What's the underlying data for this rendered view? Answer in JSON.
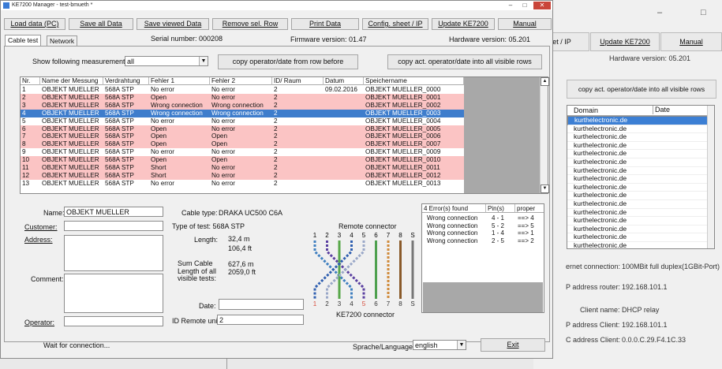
{
  "bg_window": {
    "controls": {
      "minimize": "–",
      "maximize": "□"
    },
    "toolbar_partial": [
      "et / IP",
      "Update KE7200",
      "Manual"
    ],
    "hardware_version": "Hardware version:  05.201",
    "copy_button": "copy act. operator/date into all visible rows",
    "list": {
      "columns": [
        "Domain",
        "Date"
      ],
      "rows": [
        "kurthelectronic.de",
        "kurthelectronic.de",
        "kurthelectronic.de",
        "kurthelectronic.de",
        "kurthelectronic.de",
        "kurthelectronic.de",
        "kurthelectronic.de",
        "kurthelectronic.de",
        "kurthelectronic.de",
        "kurthelectronic.de",
        "kurthelectronic.de",
        "kurthelectronic.de",
        "kurthelectronic.de",
        "kurthelectronic.de",
        "kurthelectronic.de",
        "kurthelectronic.de",
        "kurthelectronic.de",
        "kurthelectronic.de"
      ],
      "selected_index": 0
    },
    "info": [
      {
        "label": "ernet connection:",
        "value": "100MBit full duplex(1GBit-Port)"
      },
      {
        "label": "P address router:",
        "value": "192.168.101.1"
      },
      {
        "label": "Client name:",
        "value": "DHCP relay"
      },
      {
        "label": "P address Client:",
        "value": "192.168.101.1"
      },
      {
        "label": "C address Client:",
        "value": "0.0.0.C.29.F4.1C.33"
      }
    ]
  },
  "window": {
    "title": "KE7200 Manager - test-bmueth *",
    "controls": {
      "minimize": "–",
      "maximize": "□",
      "close": "✕"
    }
  },
  "toolbar": [
    "Load data (PC)",
    "Save all Data",
    "Save viewed Data",
    "Remove sel. Row",
    "Print Data",
    "Config. sheet / IP",
    "Update KE7200",
    "Manual"
  ],
  "tabs": [
    "Cable test",
    "Network"
  ],
  "serial": "Serial number: 000208",
  "firmware": "Firmware version:  01.47",
  "hardware": "Hardware version:  05.201",
  "filter": {
    "label": "Show following measurements:",
    "value": "all"
  },
  "buttons": {
    "copy_before": "copy operator/date from row before",
    "copy_all": "copy act. operator/date into all visible rows"
  },
  "table": {
    "columns": [
      "Nr.",
      "Name der Messung",
      "Verdrahtung",
      "Fehler 1",
      "Fehler 2",
      "ID/ Raum",
      "Datum",
      "Speichername"
    ],
    "rows": [
      {
        "nr": "1",
        "name": "OBJEKT MUELLER",
        "wiring": "568A STP",
        "f1": "No error",
        "f2": "No error",
        "id": "2",
        "date": "09.02.2016",
        "store": "OBJEKT MUELLER_0000",
        "style": "white"
      },
      {
        "nr": "2",
        "name": "OBJEKT MUELLER",
        "wiring": "568A STP",
        "f1": "Open",
        "f2": "No error",
        "id": "2",
        "date": "",
        "store": "OBJEKT MUELLER_0001",
        "style": "pink"
      },
      {
        "nr": "3",
        "name": "OBJEKT MUELLER",
        "wiring": "568A STP",
        "f1": "Wrong connection",
        "f2": "Wrong connection",
        "id": "2",
        "date": "",
        "store": "OBJEKT MUELLER_0002",
        "style": "pink"
      },
      {
        "nr": "4",
        "name": "OBJEKT MUELLER",
        "wiring": "568A STP",
        "f1": "Wrong connection",
        "f2": "Wrong connection",
        "id": "2",
        "date": "",
        "store": "OBJEKT MUELLER_0003",
        "style": "selected"
      },
      {
        "nr": "5",
        "name": "OBJEKT MUELLER",
        "wiring": "568A STP",
        "f1": "No error",
        "f2": "No error",
        "id": "2",
        "date": "",
        "store": "OBJEKT MUELLER_0004",
        "style": "white"
      },
      {
        "nr": "6",
        "name": "OBJEKT MUELLER",
        "wiring": "568A STP",
        "f1": "Open",
        "f2": "No error",
        "id": "2",
        "date": "",
        "store": "OBJEKT MUELLER_0005",
        "style": "pink"
      },
      {
        "nr": "7",
        "name": "OBJEKT MUELLER",
        "wiring": "568A STP",
        "f1": "Open",
        "f2": "Open",
        "id": "2",
        "date": "",
        "store": "OBJEKT MUELLER_0006",
        "style": "pink"
      },
      {
        "nr": "8",
        "name": "OBJEKT MUELLER",
        "wiring": "568A STP",
        "f1": "Open",
        "f2": "Open",
        "id": "2",
        "date": "",
        "store": "OBJEKT MUELLER_0007",
        "style": "pink"
      },
      {
        "nr": "9",
        "name": "OBJEKT MUELLER",
        "wiring": "568A STP",
        "f1": "No error",
        "f2": "No error",
        "id": "2",
        "date": "",
        "store": "OBJEKT MUELLER_0009",
        "style": "white"
      },
      {
        "nr": "10",
        "name": "OBJEKT MUELLER",
        "wiring": "568A STP",
        "f1": "Open",
        "f2": "Open",
        "id": "2",
        "date": "",
        "store": "OBJEKT MUELLER_0010",
        "style": "pink"
      },
      {
        "nr": "11",
        "name": "OBJEKT MUELLER",
        "wiring": "568A STP",
        "f1": "Short",
        "f2": "No error",
        "id": "2",
        "date": "",
        "store": "OBJEKT MUELLER_0011",
        "style": "pink"
      },
      {
        "nr": "12",
        "name": "OBJEKT MUELLER",
        "wiring": "568A STP",
        "f1": "Short",
        "f2": "No error",
        "id": "2",
        "date": "",
        "store": "OBJEKT MUELLER_0012",
        "style": "pink"
      },
      {
        "nr": "13",
        "name": "OBJEKT MUELLER",
        "wiring": "568A STP",
        "f1": "No error",
        "f2": "No error",
        "id": "2",
        "date": "",
        "store": "OBJEKT MUELLER_0013",
        "style": "white"
      }
    ],
    "row_colors": {
      "white": "#ffffff",
      "pink": "#fbc4c4",
      "selected": "#3e7dcc"
    }
  },
  "details": {
    "name_label": "Name:",
    "name_value": "OBJEKT MUELLER",
    "customer_label": "Customer:",
    "customer_value": "",
    "address_label": "Address:",
    "address_value": "",
    "comment_label": "Comment:",
    "comment_value": "",
    "operator_label": "Operator:",
    "operator_value": "",
    "cable_type_label": "Cable type:",
    "cable_type_value": "DRAKA UC500 C6A",
    "type_of_test": "Type of test: 568A STP",
    "length_label": "Length:",
    "length_m": "32,4 m",
    "length_ft": "106,4 ft",
    "sum_label": [
      "Sum Cable",
      "Length of all",
      "visible tests:"
    ],
    "sum_m": "627,6 m",
    "sum_ft": "2059,0 ft",
    "date_label": "Date:",
    "date_value": "",
    "remote_id_label": "ID Remote unit:",
    "remote_id_value": "2"
  },
  "wiring_diagram": {
    "top_label": "Remote connector",
    "bottom_label": "KE7200 connector",
    "pins": [
      "1",
      "2",
      "3",
      "4",
      "5",
      "6",
      "7",
      "8",
      "S"
    ],
    "bottom_pin_colors": [
      "#d64a3a",
      "#333333",
      "#333333",
      "#333333",
      "#d64a3a",
      "#333333",
      "#333333",
      "#333333",
      "#333333"
    ],
    "wire_colors": [
      "#3f7fc0",
      "#5a3fa0",
      "#58a84a",
      "#2f5fb0",
      "#9aa8c8",
      "#4ea04e",
      "#d08a3a",
      "#8a5a2a",
      "#777777"
    ]
  },
  "errors": {
    "columns": [
      "4 Error(s) found",
      "Pin(s)",
      "proper"
    ],
    "rows": [
      {
        "err": "Wrong connection",
        "pins": "4 - 1",
        "proper": "==> 4"
      },
      {
        "err": "Wrong connection",
        "pins": "5 - 2",
        "proper": "==> 5"
      },
      {
        "err": "Wrong connection",
        "pins": "1 - 4",
        "proper": "==> 1"
      },
      {
        "err": "Wrong connection",
        "pins": "2 - 5",
        "proper": "==> 2"
      }
    ]
  },
  "status": {
    "text": "Wait for connection...",
    "lang_label": "Sprache/Language:",
    "lang_value": "english",
    "exit": "Exit"
  }
}
